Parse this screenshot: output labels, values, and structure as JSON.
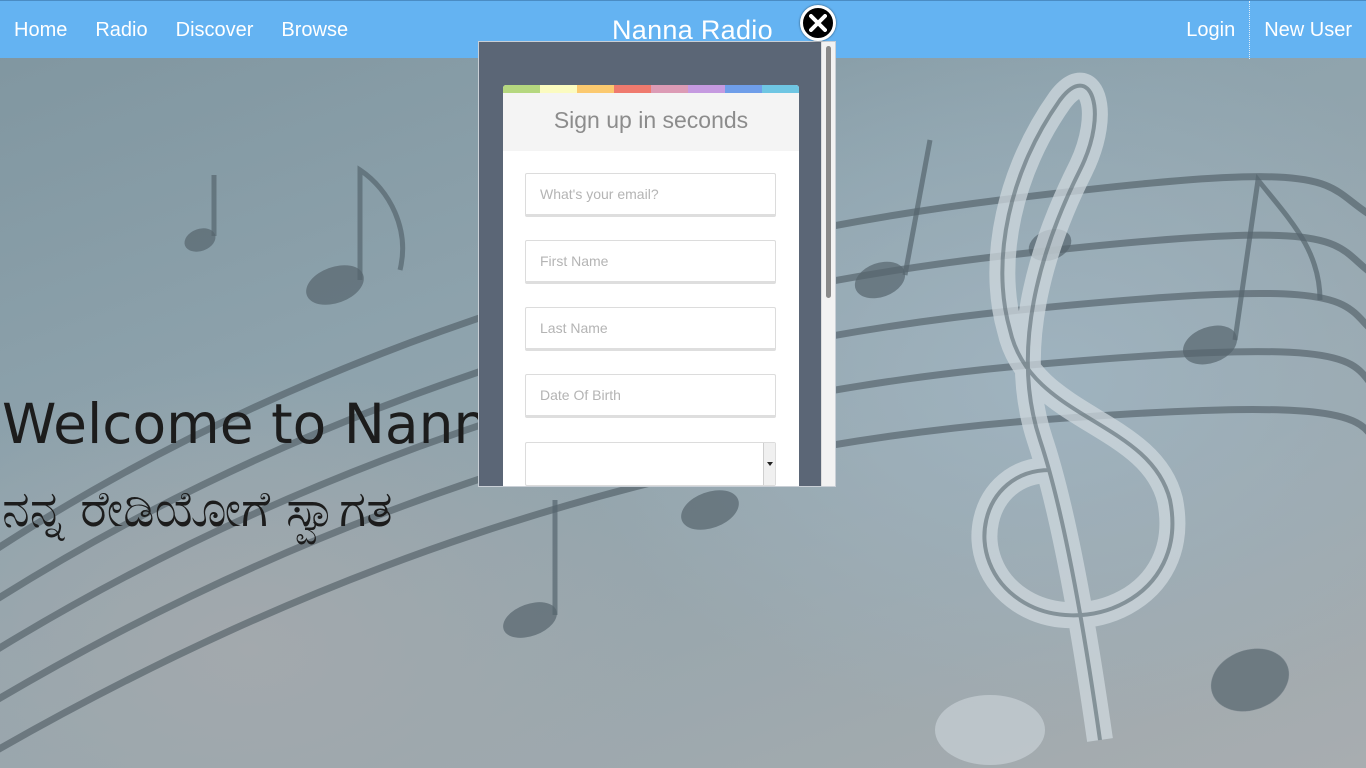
{
  "nav": {
    "links": [
      "Home",
      "Radio",
      "Discover",
      "Browse"
    ],
    "title": "Nanna Radio",
    "login": "Login",
    "new_user": "New User"
  },
  "welcome": {
    "english": "Welcome to Nanna",
    "kannada": "ನನ್ನ ರೇಡಿಯೋಗೆ ಸ್ವಾಗತ"
  },
  "signup": {
    "heading": "Sign up in seconds",
    "email_placeholder": "What's your email?",
    "first_name_placeholder": "First Name",
    "last_name_placeholder": "Last Name",
    "dob_placeholder": "Date Of Birth",
    "select_value": ""
  },
  "colors": {
    "navbar": "#64b3f2",
    "modal_bg": "#5b6676",
    "stripe": [
      "#b5d77f",
      "#fbfbc0",
      "#fbc96f",
      "#ef7a6e",
      "#dc9bb5",
      "#c59ae0",
      "#6f9ee9",
      "#6fc6e3"
    ]
  },
  "icons": {
    "close": "close-icon"
  }
}
